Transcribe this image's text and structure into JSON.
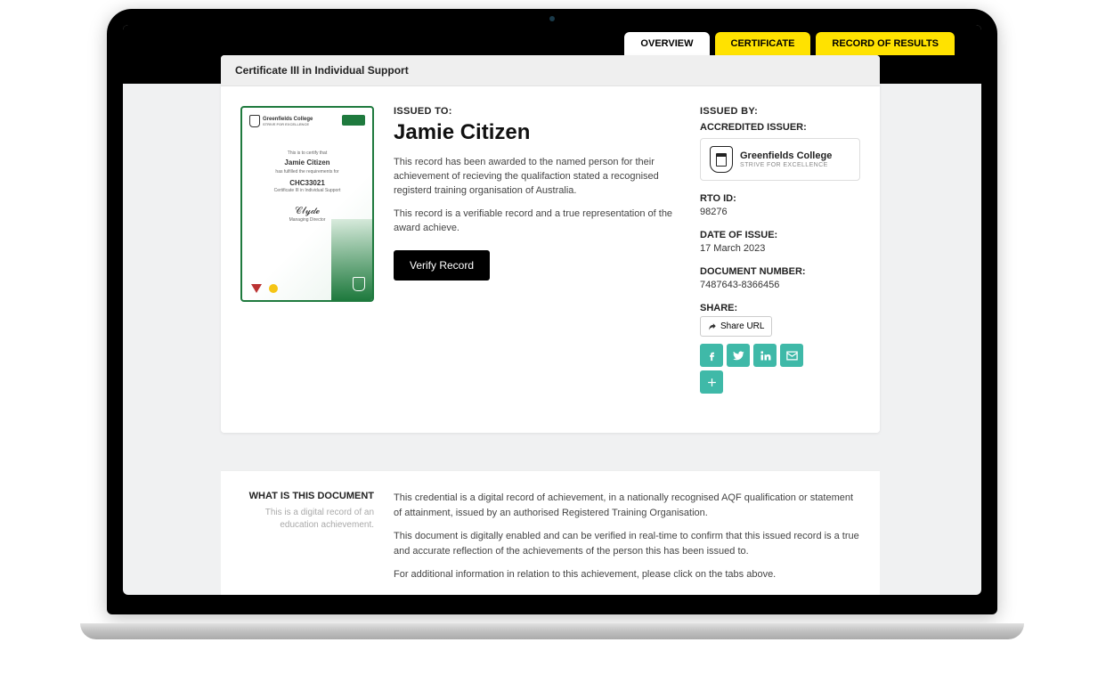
{
  "tabs": {
    "overview": "OVERVIEW",
    "certificate": "CERTIFICATE",
    "record": "RECORD OF RESULTS"
  },
  "doc_title": "Certificate III in Individual Support",
  "cert_preview": {
    "issuer_name": "Greenfields College",
    "issuer_tagline": "STRIVE FOR EXCELLENCE",
    "recipient": "Jamie Citizen",
    "pre_recipient": "This is to certify that",
    "pre_code": "has fulfilled the requirements for",
    "code": "CHC33021",
    "code_title": "Certificate III in Individual Support",
    "signatory": "Managing Director"
  },
  "issued_to": {
    "label": "ISSUED TO:",
    "name": "Jamie Citizen",
    "para1": "This record has been awarded to the named person for their achievement of recieving the qualifaction stated a recognised registerd training organisation of Australia.",
    "para2": "This record is a verifiable record and a true representation of the award achieve.",
    "verify_button": "Verify Record"
  },
  "issued_by": {
    "label": "ISSUED BY:",
    "accredited_label": "ACCREDITED ISSUER:",
    "issuer_name": "Greenfields College",
    "issuer_tagline": "STRIVE FOR EXCELLENCE",
    "rto_label": "RTO ID:",
    "rto_value": "98276",
    "date_label": "DATE OF ISSUE:",
    "date_value": "17 March 2023",
    "docnum_label": "DOCUMENT NUMBER:",
    "docnum_value": "7487643-8366456",
    "share_label": "SHARE:",
    "share_url_label": "Share URL"
  },
  "footer": {
    "heading": "WHAT IS THIS DOCUMENT",
    "sub": "This is a digital record of an education achievement.",
    "p1": "This credential is a digital record of achievement, in a nationally recognised AQF qualification or statement of attainment, issued by an authorised Registered Training Organisation.",
    "p2": "This document is digitally enabled and can be verified in real-time to confirm that this issued record is a true and accurate reflection of the achievements of the person this has been issued to.",
    "p3": "For additional information in relation to this achievement, please click on the tabs above."
  }
}
